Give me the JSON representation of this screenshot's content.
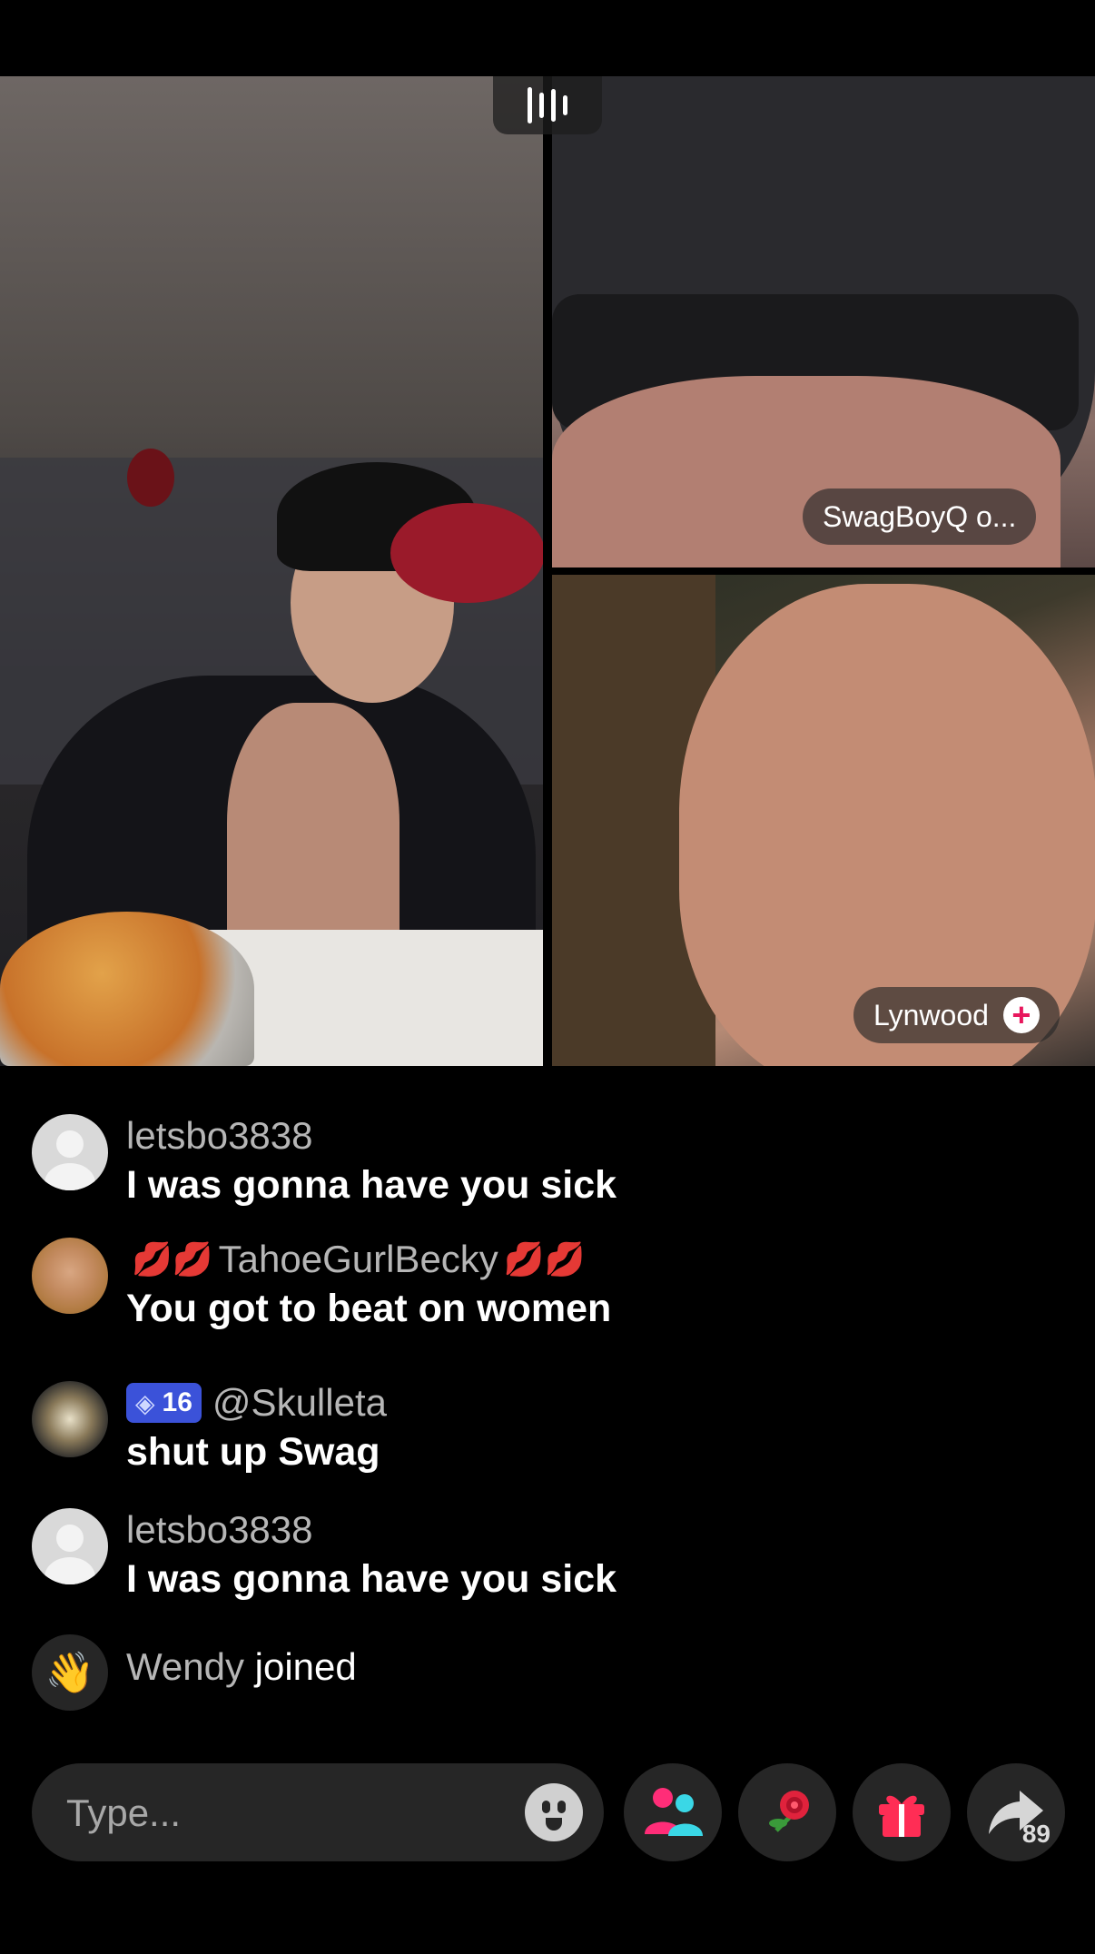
{
  "participants": {
    "top_right_name": "SwagBoyQ o...",
    "bottom_right_name": "Lynwood"
  },
  "comments": [
    {
      "username": "letsbo3838",
      "text": "I was gonna have you sick"
    },
    {
      "username": "TahoeGurlBecky",
      "username_decoration": "💋💋",
      "text": "You got to beat on women"
    },
    {
      "username": "@Skulleta",
      "level": "16",
      "text": "shut up Swag"
    },
    {
      "username": "letsbo3838",
      "text": "I was gonna have you sick"
    }
  ],
  "join_notice": {
    "name": "Wendy",
    "action": "joined"
  },
  "input": {
    "placeholder": "Type..."
  },
  "actions": {
    "share_count": "89"
  },
  "colors": {
    "accent_pink": "#e8175d",
    "level_badge": "#3b52d9"
  }
}
